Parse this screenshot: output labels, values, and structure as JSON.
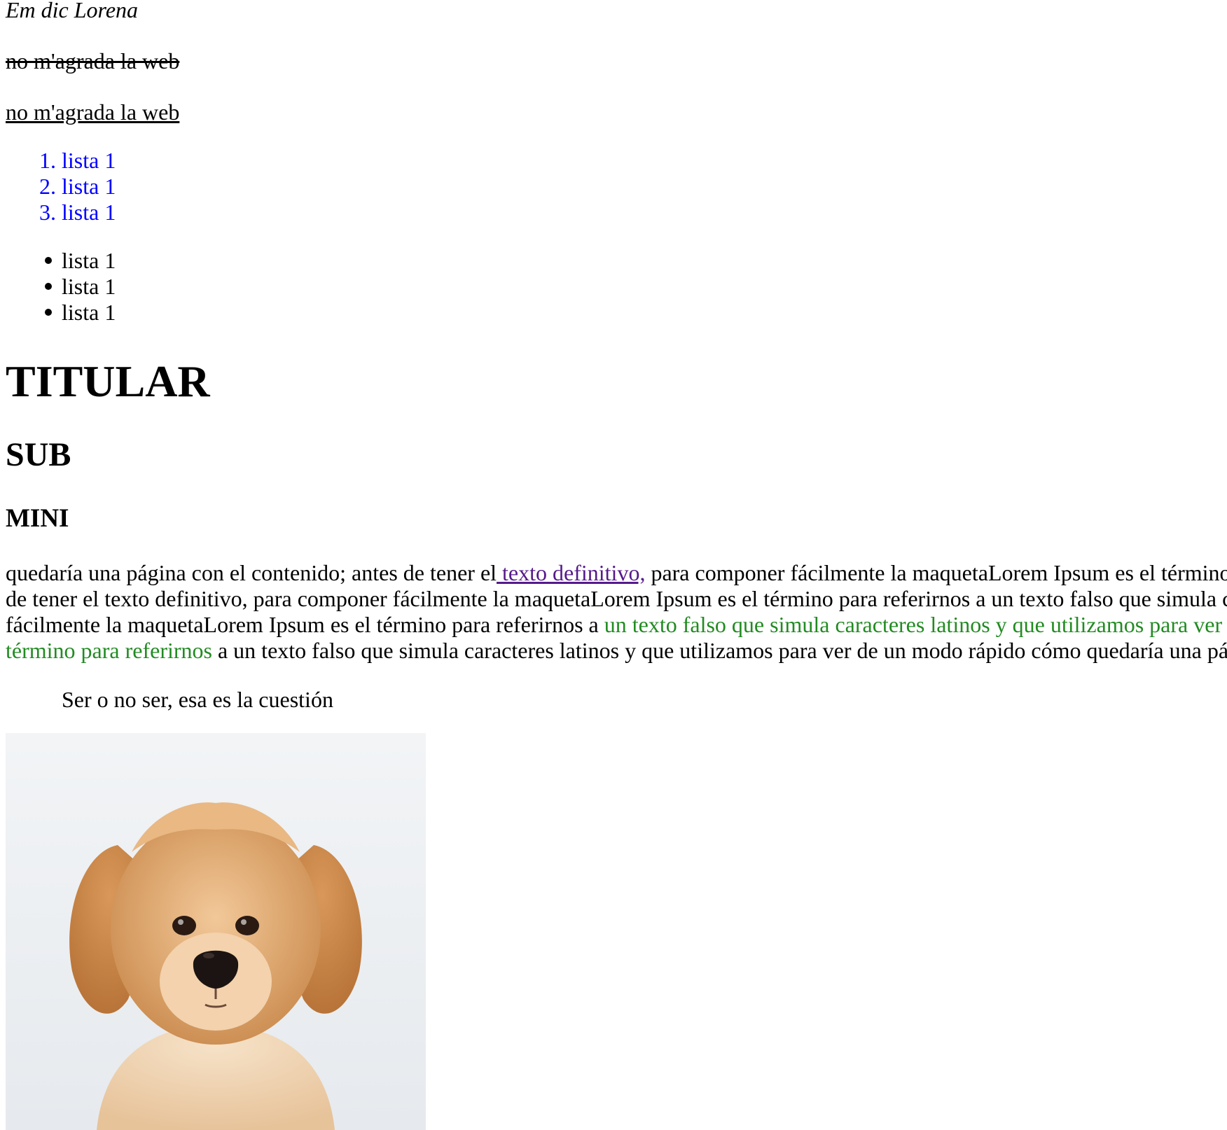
{
  "em_text": "Em dic Lorena",
  "strike_text": "no m'agrada la web",
  "underline_text": "no m'agrada la web",
  "ordered_list": {
    "color": "#0000ff",
    "items": [
      {
        "number": "1.",
        "label": "lista 1"
      },
      {
        "number": "2.",
        "label": "lista 1"
      },
      {
        "number": "3.",
        "label": "lista 1"
      }
    ]
  },
  "unordered_list": {
    "items": [
      {
        "label": "lista 1"
      },
      {
        "label": "lista 1"
      },
      {
        "label": "lista 1"
      }
    ]
  },
  "headings": {
    "h1": "TITULAR",
    "h2": "SUB",
    "h3": "MINI"
  },
  "paragraph": {
    "line1_a": "quedaría una página con el contenido; antes de tener el",
    "line1_link": " texto definitivo,",
    "line1_b": " para componer fácilmente la maquetaLorem Ipsum es el término",
    "line2": "de tener el texto definitivo, para componer fácilmente la maquetaLorem Ipsum es el término para referirnos a un texto falso que simula c",
    "line3_a": "fácilmente la maquetaLorem Ipsum es el término para referirnos a ",
    "line3_green": "un texto falso que simula caracteres latinos y que utilizamos para ver",
    "line4_green": "término para referirnos",
    "line4_b": " a un texto falso que simula caracteres latinos y que utilizamos para ver de un modo rápido cómo quedaría una pá",
    "link_color": "#551a8b",
    "green_color": "#228b22"
  },
  "blockquote": "Ser o no ser, esa es la cuestión",
  "image": {
    "subject": "golden retriever puppy",
    "background": "#eef1f4"
  }
}
